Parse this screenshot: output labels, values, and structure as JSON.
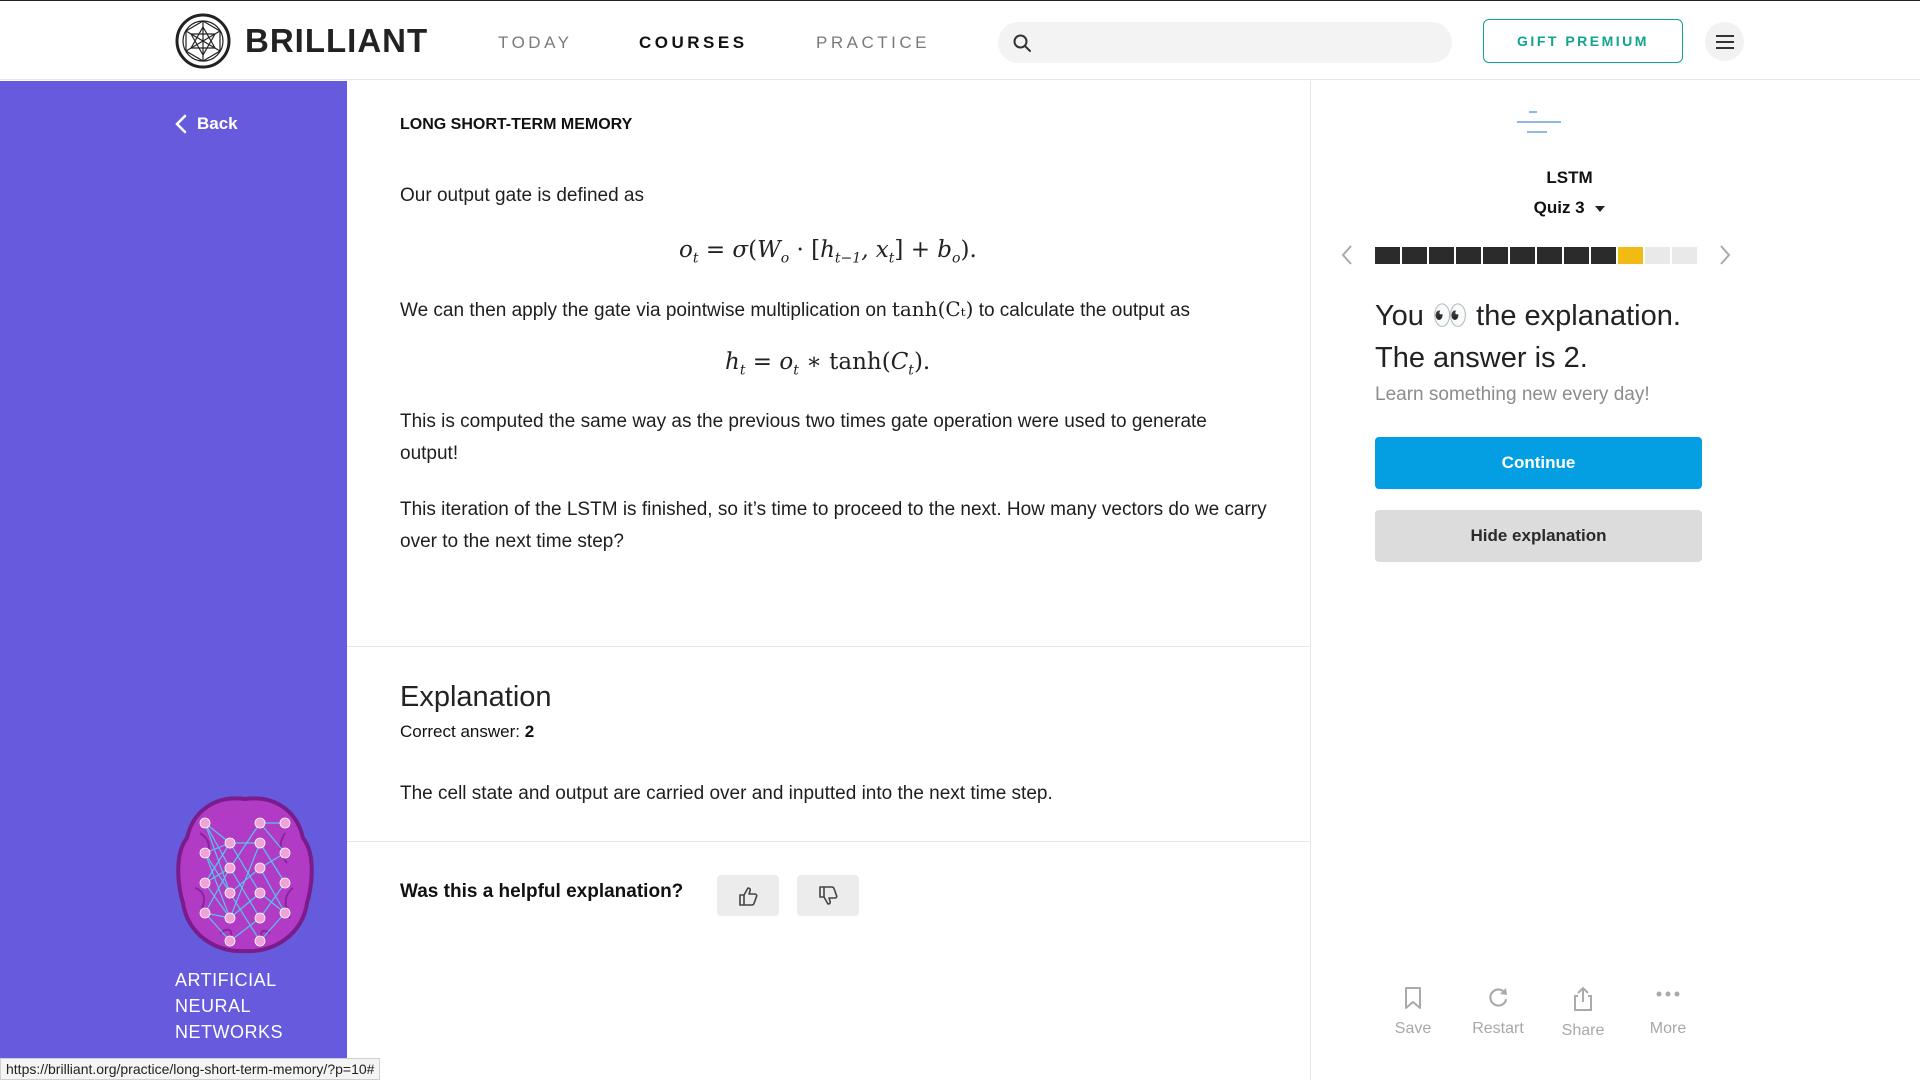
{
  "header": {
    "brand": "BRILLIANT",
    "nav": {
      "today": "TODAY",
      "courses": "COURSES",
      "practice": "PRACTICE"
    },
    "search_placeholder": "",
    "gift_label": "GIFT PREMIUM"
  },
  "sidebar": {
    "back_label": "Back",
    "course_line1": "ARTIFICIAL",
    "course_line2": "NEURAL",
    "course_line3": "NETWORKS"
  },
  "content": {
    "kicker": "LONG SHORT-TERM MEMORY",
    "p1": "Our output gate is defined as",
    "p2_before": "We can then apply the gate via pointwise multiplication on",
    "p2_math": "tanh(Cₜ)",
    "p2_after": "to calculate the output as",
    "p3": "This is computed the same way as the previous two times gate operation were used to generate output!",
    "p4": "This iteration of the LSTM is finished, so it’s time to proceed to the next. How many vectors do we carry over to the next time step?"
  },
  "explanation": {
    "title": "Explanation",
    "correct_label": "Correct answer:",
    "correct_value": "2",
    "text": "The cell state and output are carried over and inputted into the next time step.",
    "helpful_question": "Was this a helpful explanation?"
  },
  "quiz": {
    "topic": "LSTM",
    "quiz_label": "Quiz 3",
    "progress": {
      "total": 12,
      "completed": 9,
      "current": 10
    },
    "result_you": "You",
    "result_emoji": "👀",
    "result_rest": "the explanation.",
    "result_line2": "The answer is 2.",
    "learn_text": "Learn something new every day!",
    "continue_label": "Continue",
    "hide_label": "Hide explanation",
    "actions": {
      "save": "Save",
      "restart": "Restart",
      "share": "Share",
      "more": "More"
    }
  },
  "status_url": "https://brilliant.org/practice/long-short-term-memory/?p=10#",
  "colors": {
    "sidebar": "#655bdc",
    "accent_teal": "#12a38e",
    "continue_blue": "#049ee3",
    "progress_current": "#f2bb13",
    "progress_done": "#2b2b2b"
  }
}
